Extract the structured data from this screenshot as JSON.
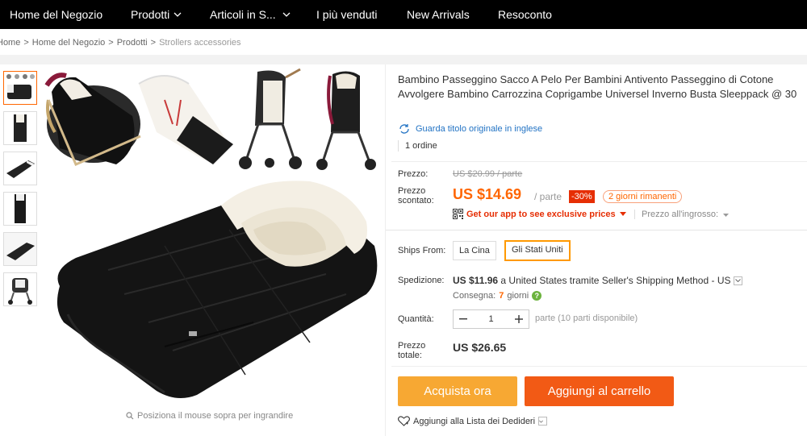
{
  "nav": {
    "items": [
      {
        "label": "Home del Negozio",
        "has_dropdown": false
      },
      {
        "label": "Prodotti",
        "has_dropdown": true
      },
      {
        "label": "Articoli in S...",
        "has_dropdown": true
      },
      {
        "label": "I più venduti",
        "has_dropdown": false
      },
      {
        "label": "New Arrivals",
        "has_dropdown": false
      },
      {
        "label": "Resoconto",
        "has_dropdown": false
      }
    ]
  },
  "breadcrumb": {
    "items": [
      "Home",
      "Home del Negozio",
      "Prodotti",
      "Strollers accessories"
    ],
    "separator": ">"
  },
  "gallery": {
    "zoom_hint": "Posiziona il mouse sopra per ingrandire",
    "thumb_count": 6
  },
  "product": {
    "title": "Bambino Passeggino Sacco A Pelo Per Bambini Antivento Passeggino di Cotone Avvolgere Bambino Carrozzina Coprigambe Universel Inverno Busta Sleeppack @ 30",
    "translate_link": "Guarda titolo originale in inglese",
    "orders": "1 ordine"
  },
  "pricing": {
    "price_label": "Prezzo:",
    "original_price": "US $20.99 / parte",
    "discount_label_1": "Prezzo",
    "discount_label_2": "scontato:",
    "discount_price": "US $14.69",
    "unit": "/ parte",
    "discount_badge": "-30%",
    "days_left": "2 giorni rimanenti",
    "app_promo": "Get our app to see exclusive prices",
    "wholesale": "Prezzo all'ingrosso:"
  },
  "shipping": {
    "ships_from_label": "Ships From:",
    "options": [
      "La Cina",
      "Gli Stati Uniti"
    ],
    "selected": "Gli Stati Uniti",
    "label": "Spedizione:",
    "cost": "US $11.96",
    "method": "a United States tramite Seller's Shipping Method - US",
    "delivery_label": "Consegna:",
    "delivery_days": "7",
    "delivery_unit": "giorni"
  },
  "quantity": {
    "label": "Quantità:",
    "value": "1",
    "available": "parte (10 parti disponibile)"
  },
  "total": {
    "label_1": "Prezzo",
    "label_2": "totale:",
    "value": "US $26.65"
  },
  "actions": {
    "buy_now": "Acquista ora",
    "add_to_cart": "Aggiungi al carrello",
    "wishlist": "Aggiungi alla Lista dei Dedideri"
  },
  "colors": {
    "accent_orange": "#f60",
    "buy_button": "#f7a833",
    "cart_button": "#f25a15",
    "discount_badge": "#e62e04",
    "nav_bg": "#000000",
    "link_blue": "#2273c4"
  },
  "icons": [
    "chevron-down-icon",
    "translate-icon",
    "qr-code-icon",
    "search-icon",
    "help-icon",
    "heart-icon"
  ]
}
